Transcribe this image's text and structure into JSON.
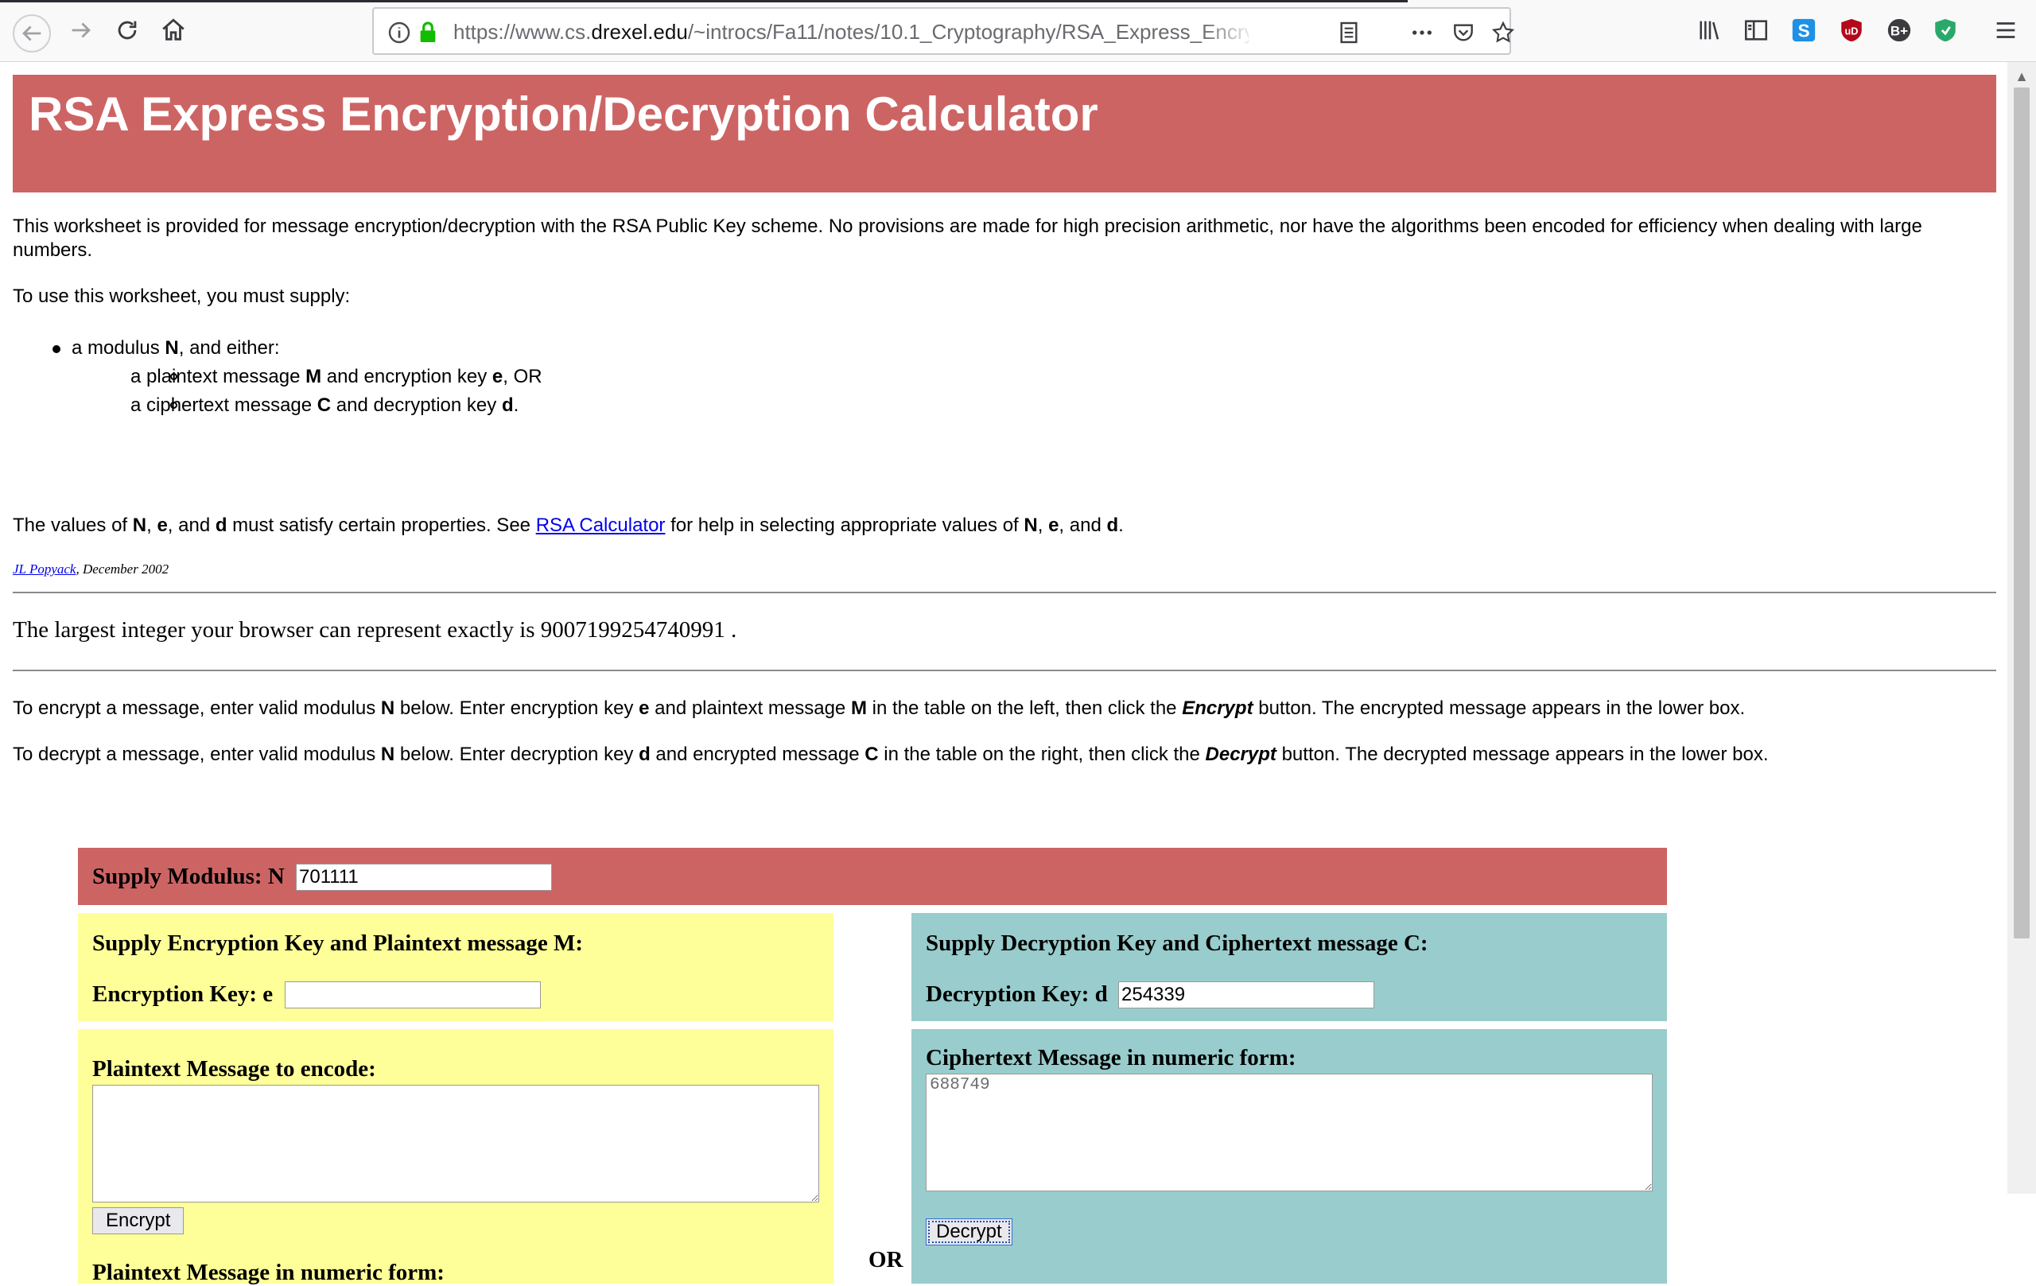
{
  "browser": {
    "url_prefix": "https://www.cs.",
    "url_domain": "drexel.edu",
    "url_suffix": "/~introcs/Fa11/notes/10.1_Cryptography/RSA_Express_EncryptDe"
  },
  "page": {
    "title": "RSA Express Encryption/Decryption Calculator",
    "intro": "This worksheet is provided for message encryption/decryption with the RSA Public Key scheme. No provisions are made for high precision arithmetic, nor have the algorithms been encoded for efficiency when dealing with large numbers.",
    "supply_intro": "To use this worksheet, you must supply:",
    "bullet_main": "a modulus N, and either:",
    "bullet_sub1": "a plaintext message M and encryption key e, OR",
    "bullet_sub2": "a ciphertext message C and decryption key d.",
    "props_pre": "The values of N, e, and d must satisfy certain properties. See ",
    "props_link": "RSA Calculator",
    "props_post": " for help in selecting appropriate values of N, e, and d.",
    "author_name": "JL Popyack",
    "author_date": ", December 2002",
    "largest_int": "The largest integer your browser can represent exactly is 9007199254740991 .",
    "encrypt_instructions": "To encrypt a message, enter valid modulus N below. Enter encryption key e and plaintext message M in the table on the left, then click the Encrypt button. The encrypted message appears in the lower box.",
    "decrypt_instructions": "To decrypt a message, enter valid modulus N below. Enter decryption key d and encrypted message C in the table on the right, then click the Decrypt button. The decrypted message appears in the lower box."
  },
  "calculator": {
    "modulus_label": "Supply Modulus: N",
    "modulus_value": "701111",
    "left_heading": "Supply Encryption Key and Plaintext message M:",
    "enc_key_label": "Encryption Key: e",
    "enc_key_value": "",
    "plaintext_label": "Plaintext Message to encode:",
    "plaintext_value": "",
    "encrypt_button": "Encrypt",
    "left_bottom_label": "Plaintext Message in numeric form:",
    "right_heading": "Supply Decryption Key and Ciphertext message C:",
    "dec_key_label": "Decryption Key: d",
    "dec_key_value": "254339",
    "ciphertext_label": "Ciphertext Message in numeric form:",
    "ciphertext_value": "688749",
    "decrypt_button": "Decrypt",
    "or_label": "OR"
  }
}
